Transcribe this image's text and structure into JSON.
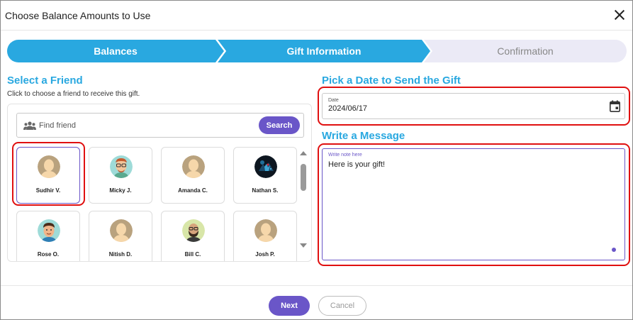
{
  "dialog": {
    "title": "Choose Balance Amounts to Use",
    "close_icon": "close-icon"
  },
  "stepper": {
    "steps": [
      {
        "label": "Balances",
        "state": "complete"
      },
      {
        "label": "Gift Information",
        "state": "active"
      },
      {
        "label": "Confirmation",
        "state": "pending"
      }
    ]
  },
  "friends": {
    "title": "Select a Friend",
    "hint": "Click to choose a friend to receive this gift.",
    "search": {
      "placeholder": "Find friend",
      "value": "",
      "button_label": "Search",
      "icon": "people-icon"
    },
    "list": [
      {
        "name": "Sudhir V.",
        "avatar": "default-avatar",
        "selected": true
      },
      {
        "name": "Micky J.",
        "avatar": "glasses-avatar",
        "selected": false
      },
      {
        "name": "Amanda C.",
        "avatar": "default-avatar",
        "selected": false
      },
      {
        "name": "Nathan S.",
        "avatar": "photo-avatar",
        "selected": false
      },
      {
        "name": "Rose O.",
        "avatar": "cartoon-avatar",
        "selected": false
      },
      {
        "name": "Nitish D.",
        "avatar": "default-avatar",
        "selected": false
      },
      {
        "name": "Bill C.",
        "avatar": "bald-bearded-avatar",
        "selected": false
      },
      {
        "name": "Josh P.",
        "avatar": "default-avatar",
        "selected": false
      }
    ]
  },
  "date": {
    "title": "Pick a Date to Send the Gift",
    "label": "Date",
    "value": "2024/06/17",
    "icon": "calendar-icon"
  },
  "message": {
    "title": "Write a Message",
    "label": "Write note here",
    "value": "Here is your gift!"
  },
  "footer": {
    "next_label": "Next",
    "cancel_label": "Cancel"
  },
  "colors": {
    "accent": "#29a8e0",
    "primary": "#6a56c8",
    "highlight": "#e01010",
    "step_pending": "#ebeaf6"
  }
}
